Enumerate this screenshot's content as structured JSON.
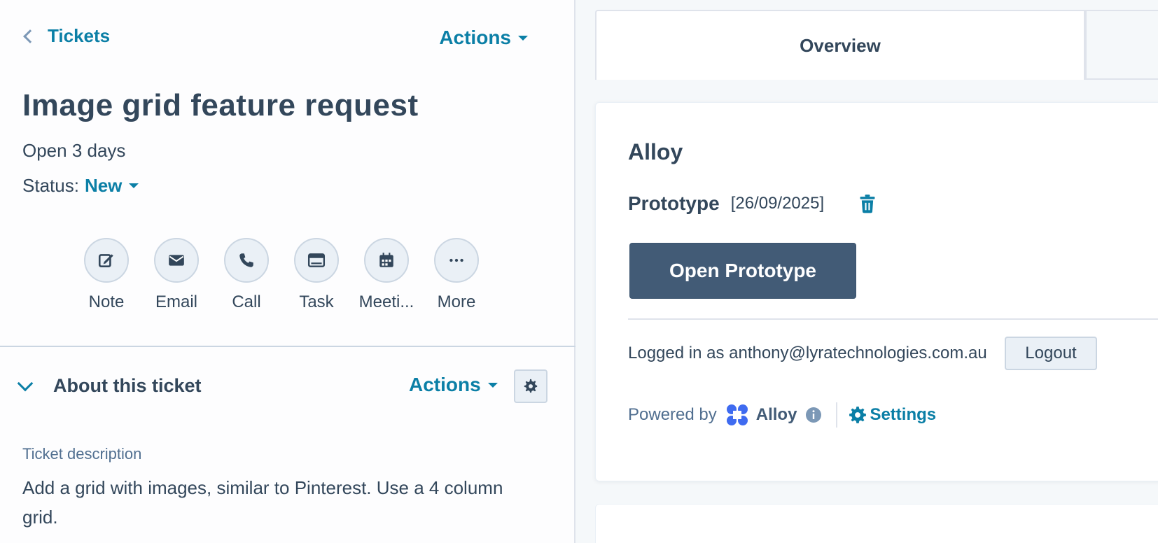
{
  "header": {
    "back_label": "Tickets",
    "actions_label": "Actions"
  },
  "ticket": {
    "title": "Image grid feature request",
    "open_duration": "Open 3 days",
    "status_label": "Status:",
    "status_value": "New"
  },
  "quick_actions": [
    {
      "label": "Note",
      "icon": "note-icon"
    },
    {
      "label": "Email",
      "icon": "email-icon"
    },
    {
      "label": "Call",
      "icon": "call-icon"
    },
    {
      "label": "Task",
      "icon": "task-icon"
    },
    {
      "label": "Meeti...",
      "icon": "meeting-icon"
    },
    {
      "label": "More",
      "icon": "more-icon"
    }
  ],
  "about": {
    "heading": "About this ticket",
    "actions_label": "Actions",
    "description_label": "Ticket description",
    "description_text": "Add a grid with images, similar to Pinterest. Use a 4 column grid."
  },
  "tabs": {
    "overview": "Overview"
  },
  "alloy_card": {
    "heading": "Alloy",
    "prototype_name": "Prototype",
    "prototype_date": "[26/09/2025]",
    "open_button": "Open Prototype",
    "logged_in_text": "Logged in as anthony@lyratechnologies.com.au",
    "logout_button": "Logout",
    "powered_by": "Powered by",
    "brand_name": "Alloy",
    "settings_label": "Settings"
  },
  "colors": {
    "accent": "#0b7fa6",
    "text": "#33475b",
    "primary_button": "#425b76",
    "alloy_brand": "#3f6bf0"
  }
}
